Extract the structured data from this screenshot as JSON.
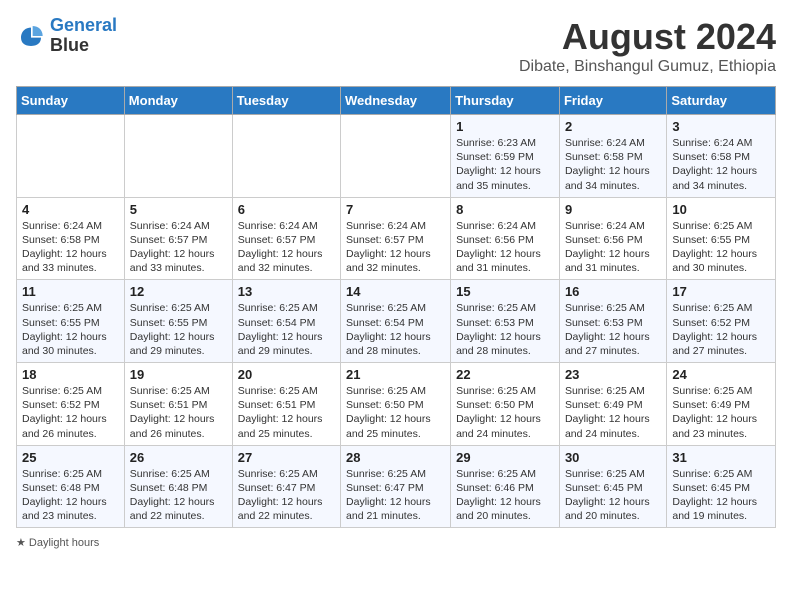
{
  "logo": {
    "line1": "General",
    "line2": "Blue"
  },
  "title": "August 2024",
  "subtitle": "Dibate, Binshangul Gumuz, Ethiopia",
  "days_of_week": [
    "Sunday",
    "Monday",
    "Tuesday",
    "Wednesday",
    "Thursday",
    "Friday",
    "Saturday"
  ],
  "weeks": [
    [
      {
        "num": "",
        "info": ""
      },
      {
        "num": "",
        "info": ""
      },
      {
        "num": "",
        "info": ""
      },
      {
        "num": "",
        "info": ""
      },
      {
        "num": "1",
        "info": "Sunrise: 6:23 AM\nSunset: 6:59 PM\nDaylight: 12 hours\nand 35 minutes."
      },
      {
        "num": "2",
        "info": "Sunrise: 6:24 AM\nSunset: 6:58 PM\nDaylight: 12 hours\nand 34 minutes."
      },
      {
        "num": "3",
        "info": "Sunrise: 6:24 AM\nSunset: 6:58 PM\nDaylight: 12 hours\nand 34 minutes."
      }
    ],
    [
      {
        "num": "4",
        "info": "Sunrise: 6:24 AM\nSunset: 6:58 PM\nDaylight: 12 hours\nand 33 minutes."
      },
      {
        "num": "5",
        "info": "Sunrise: 6:24 AM\nSunset: 6:57 PM\nDaylight: 12 hours\nand 33 minutes."
      },
      {
        "num": "6",
        "info": "Sunrise: 6:24 AM\nSunset: 6:57 PM\nDaylight: 12 hours\nand 32 minutes."
      },
      {
        "num": "7",
        "info": "Sunrise: 6:24 AM\nSunset: 6:57 PM\nDaylight: 12 hours\nand 32 minutes."
      },
      {
        "num": "8",
        "info": "Sunrise: 6:24 AM\nSunset: 6:56 PM\nDaylight: 12 hours\nand 31 minutes."
      },
      {
        "num": "9",
        "info": "Sunrise: 6:24 AM\nSunset: 6:56 PM\nDaylight: 12 hours\nand 31 minutes."
      },
      {
        "num": "10",
        "info": "Sunrise: 6:25 AM\nSunset: 6:55 PM\nDaylight: 12 hours\nand 30 minutes."
      }
    ],
    [
      {
        "num": "11",
        "info": "Sunrise: 6:25 AM\nSunset: 6:55 PM\nDaylight: 12 hours\nand 30 minutes."
      },
      {
        "num": "12",
        "info": "Sunrise: 6:25 AM\nSunset: 6:55 PM\nDaylight: 12 hours\nand 29 minutes."
      },
      {
        "num": "13",
        "info": "Sunrise: 6:25 AM\nSunset: 6:54 PM\nDaylight: 12 hours\nand 29 minutes."
      },
      {
        "num": "14",
        "info": "Sunrise: 6:25 AM\nSunset: 6:54 PM\nDaylight: 12 hours\nand 28 minutes."
      },
      {
        "num": "15",
        "info": "Sunrise: 6:25 AM\nSunset: 6:53 PM\nDaylight: 12 hours\nand 28 minutes."
      },
      {
        "num": "16",
        "info": "Sunrise: 6:25 AM\nSunset: 6:53 PM\nDaylight: 12 hours\nand 27 minutes."
      },
      {
        "num": "17",
        "info": "Sunrise: 6:25 AM\nSunset: 6:52 PM\nDaylight: 12 hours\nand 27 minutes."
      }
    ],
    [
      {
        "num": "18",
        "info": "Sunrise: 6:25 AM\nSunset: 6:52 PM\nDaylight: 12 hours\nand 26 minutes."
      },
      {
        "num": "19",
        "info": "Sunrise: 6:25 AM\nSunset: 6:51 PM\nDaylight: 12 hours\nand 26 minutes."
      },
      {
        "num": "20",
        "info": "Sunrise: 6:25 AM\nSunset: 6:51 PM\nDaylight: 12 hours\nand 25 minutes."
      },
      {
        "num": "21",
        "info": "Sunrise: 6:25 AM\nSunset: 6:50 PM\nDaylight: 12 hours\nand 25 minutes."
      },
      {
        "num": "22",
        "info": "Sunrise: 6:25 AM\nSunset: 6:50 PM\nDaylight: 12 hours\nand 24 minutes."
      },
      {
        "num": "23",
        "info": "Sunrise: 6:25 AM\nSunset: 6:49 PM\nDaylight: 12 hours\nand 24 minutes."
      },
      {
        "num": "24",
        "info": "Sunrise: 6:25 AM\nSunset: 6:49 PM\nDaylight: 12 hours\nand 23 minutes."
      }
    ],
    [
      {
        "num": "25",
        "info": "Sunrise: 6:25 AM\nSunset: 6:48 PM\nDaylight: 12 hours\nand 23 minutes."
      },
      {
        "num": "26",
        "info": "Sunrise: 6:25 AM\nSunset: 6:48 PM\nDaylight: 12 hours\nand 22 minutes."
      },
      {
        "num": "27",
        "info": "Sunrise: 6:25 AM\nSunset: 6:47 PM\nDaylight: 12 hours\nand 22 minutes."
      },
      {
        "num": "28",
        "info": "Sunrise: 6:25 AM\nSunset: 6:47 PM\nDaylight: 12 hours\nand 21 minutes."
      },
      {
        "num": "29",
        "info": "Sunrise: 6:25 AM\nSunset: 6:46 PM\nDaylight: 12 hours\nand 20 minutes."
      },
      {
        "num": "30",
        "info": "Sunrise: 6:25 AM\nSunset: 6:45 PM\nDaylight: 12 hours\nand 20 minutes."
      },
      {
        "num": "31",
        "info": "Sunrise: 6:25 AM\nSunset: 6:45 PM\nDaylight: 12 hours\nand 19 minutes."
      }
    ]
  ],
  "footer": "Daylight hours"
}
